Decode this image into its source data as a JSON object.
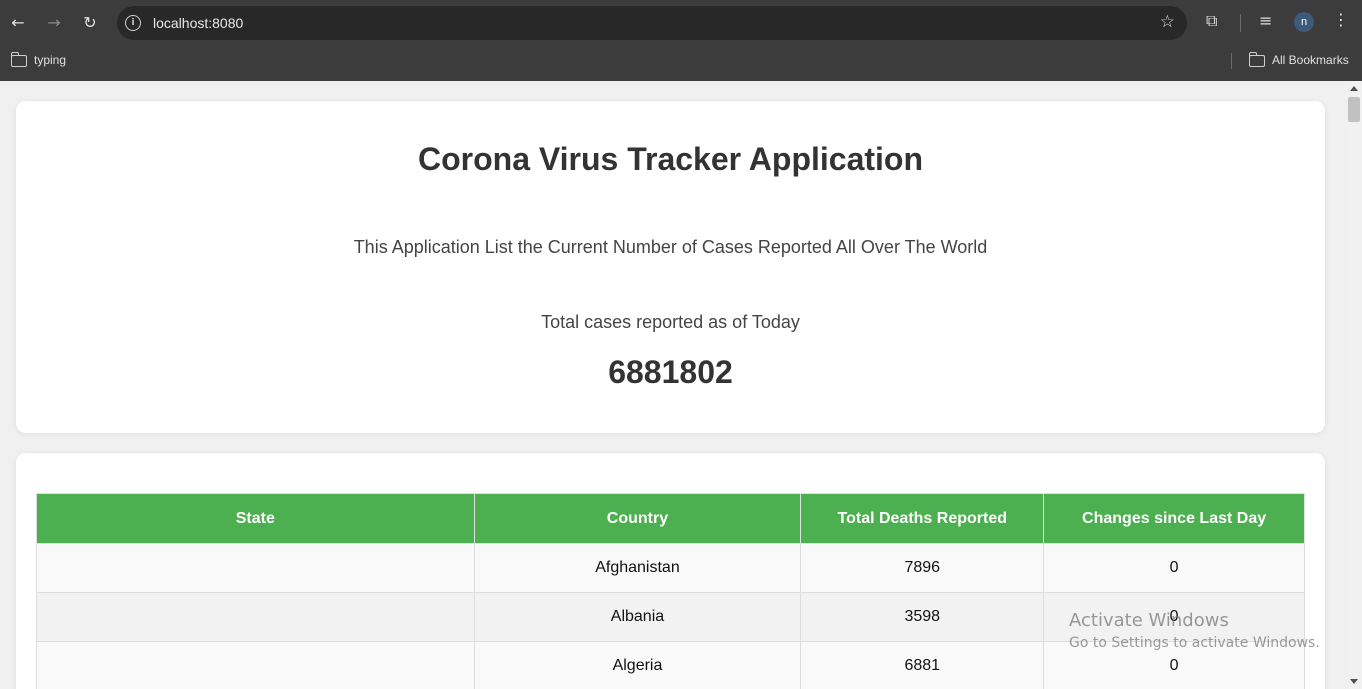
{
  "browser": {
    "url": "localhost:8080",
    "bookmarks": [
      {
        "label": "typing"
      },
      {
        "label": "All Bookmarks"
      }
    ],
    "profile_initial": "n"
  },
  "page": {
    "title": "Corona Virus Tracker Application",
    "subtitle": "This Application List the Current Number of Cases Reported All Over The World",
    "total_label": "Total cases reported as of Today",
    "total_value": "6881802"
  },
  "table": {
    "headers": [
      "State",
      "Country",
      "Total Deaths Reported",
      "Changes since Last Day"
    ],
    "rows": [
      {
        "state": "",
        "country": "Afghanistan",
        "deaths": "7896",
        "change": "0"
      },
      {
        "state": "",
        "country": "Albania",
        "deaths": "3598",
        "change": "0"
      },
      {
        "state": "",
        "country": "Algeria",
        "deaths": "6881",
        "change": "0"
      }
    ],
    "header_color": "#4caf50"
  },
  "watermark": {
    "line1": "Activate Windows",
    "line2": "Go to Settings to activate Windows."
  }
}
